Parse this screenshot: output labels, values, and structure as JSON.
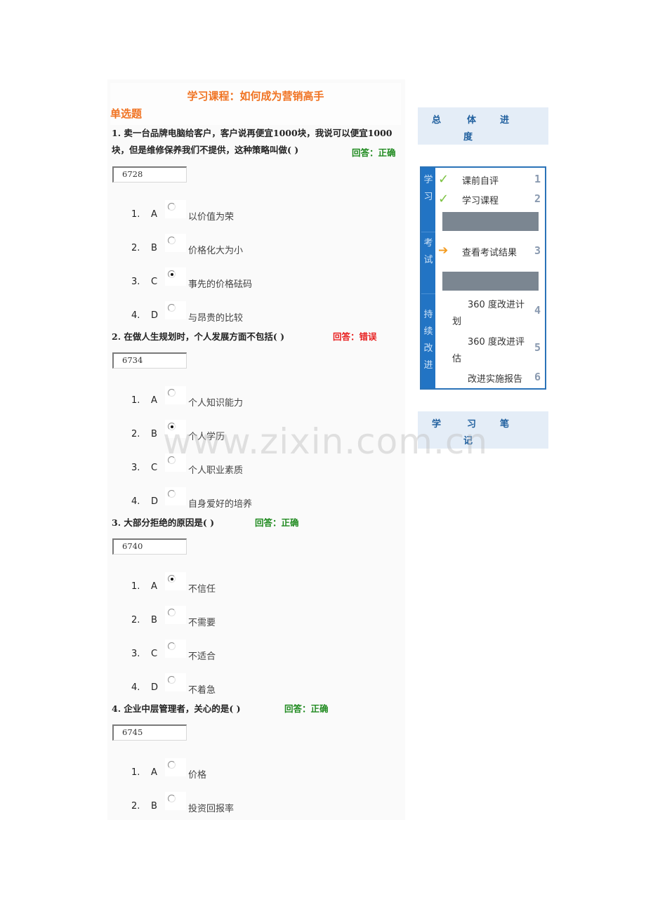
{
  "course_title": "学习课程：如何成为营销高手",
  "section_title": "单选题",
  "questions": [
    {
      "text_line1": "1. 卖一台品牌电脑给客户，客户说再便宜1000块，我说可以便宜1000",
      "text_line2": "块，但是维修保养我们不提供，这种策略叫做( )",
      "answer": "回答：正确",
      "answer_status": "correct",
      "code": "6728",
      "options": [
        {
          "num": "1.",
          "letter": "A",
          "text": "以价值为荣",
          "selected": false
        },
        {
          "num": "2.",
          "letter": "B",
          "text": "价格化大为小",
          "selected": false
        },
        {
          "num": "3.",
          "letter": "C",
          "text": "事先的价格砝码",
          "selected": true
        },
        {
          "num": "4.",
          "letter": "D",
          "text": "与昂贵的比较",
          "selected": false
        }
      ]
    },
    {
      "text_line1": "2. 在做人生规划时，个人发展方面不包括( )",
      "answer": "回答：错误",
      "answer_status": "wrong",
      "code": "6734",
      "options": [
        {
          "num": "1.",
          "letter": "A",
          "text": "个人知识能力",
          "selected": false
        },
        {
          "num": "2.",
          "letter": "B",
          "text": "个人学历",
          "selected": true
        },
        {
          "num": "3.",
          "letter": "C",
          "text": "个人职业素质",
          "selected": false
        },
        {
          "num": "4.",
          "letter": "D",
          "text": "自身爱好的培养",
          "selected": false
        }
      ]
    },
    {
      "text_line1": "3. 大部分拒绝的原因是( )",
      "answer": "回答：正确",
      "answer_status": "correct",
      "code": "6740",
      "options": [
        {
          "num": "1.",
          "letter": "A",
          "text": "不信任",
          "selected": true
        },
        {
          "num": "2.",
          "letter": "B",
          "text": "不需要",
          "selected": false
        },
        {
          "num": "3.",
          "letter": "C",
          "text": "不适合",
          "selected": false
        },
        {
          "num": "4.",
          "letter": "D",
          "text": "不着急",
          "selected": false
        }
      ]
    },
    {
      "text_line1": "4. 企业中层管理者，关心的是( )",
      "answer": "回答：正确",
      "answer_status": "correct",
      "code": "6745",
      "options": [
        {
          "num": "1.",
          "letter": "A",
          "text": "价格",
          "selected": false
        },
        {
          "num": "2.",
          "letter": "B",
          "text": "投资回报率",
          "selected": false
        }
      ]
    }
  ],
  "sidebar": {
    "overall_progress": {
      "c1": "总",
      "c2": "体",
      "c3": "进",
      "c4": "度"
    },
    "sections": [
      {
        "label_1": "学",
        "label_2": "习"
      },
      {
        "label_1": "考",
        "label_2": "试"
      },
      {
        "label_1": "持",
        "label_2": "续",
        "label_3": "改",
        "label_4": "进"
      }
    ],
    "steps": [
      {
        "label": "课前自评",
        "num": "1",
        "status": "done"
      },
      {
        "label": "学习课程",
        "num": "2",
        "status": "done"
      },
      {
        "label": "查看考试结果",
        "num": "3",
        "status": "current"
      },
      {
        "label_1": "360 度改进计",
        "label_2": "划",
        "num": "4"
      },
      {
        "label_1": "360 度改进评",
        "label_2": "估",
        "num": "5"
      },
      {
        "label": "改进实施报告",
        "num": "6"
      }
    ],
    "notes": {
      "c1": "学",
      "c2": "习",
      "c3": "笔",
      "c4": "记"
    }
  },
  "watermark": "www.zixin.com.cn",
  "colors": {
    "accent_orange": "#f07322",
    "correct_green": "#1f8a1f",
    "wrong_red": "#e81f1f",
    "rail_blue": "#2274c4"
  }
}
